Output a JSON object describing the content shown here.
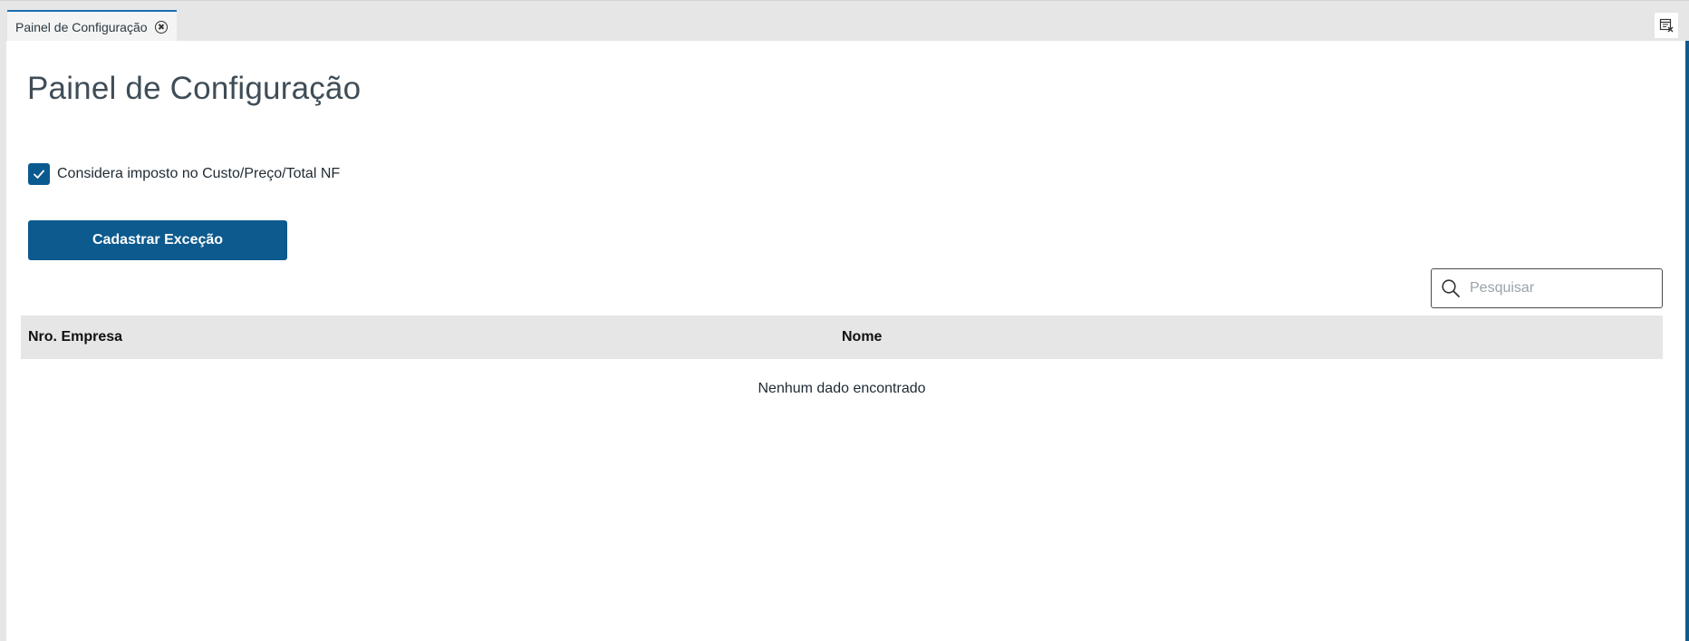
{
  "tab": {
    "title": "Painel de Configuração"
  },
  "page": {
    "title": "Painel de Configuração"
  },
  "option": {
    "label": "Considera imposto no Custo/Preço/Total NF",
    "checked": true
  },
  "actions": {
    "register_exception": "Cadastrar Exceção"
  },
  "search": {
    "placeholder": "Pesquisar"
  },
  "table": {
    "columns": [
      "Nro. Empresa",
      "Nome"
    ],
    "empty_message": "Nenhum dado encontrado"
  },
  "colors": {
    "primary": "#0c5a8e",
    "tab_accent": "#1a6fb0"
  },
  "icons": {
    "tab_close": "close-circle-icon",
    "corner": "window-close-icon",
    "checkbox": "check-icon",
    "search": "search-icon"
  }
}
